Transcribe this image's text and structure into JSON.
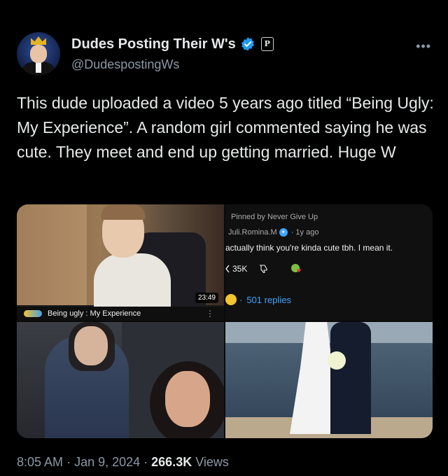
{
  "author": {
    "display_name": "Dudes Posting Their W's",
    "handle": "@DudespostingWs",
    "affiliate_badge": "P"
  },
  "tweet": {
    "text": "This dude uploaded a video 5 years ago titled “Being Ugly: My Experience”. A random girl commented saying he was cute. They meet and end up getting married. Huge W"
  },
  "media": {
    "video": {
      "duration": "23:49",
      "title": "Being ugly : My Experience"
    },
    "comment": {
      "pinned_label": "Pinned by Never Give Up",
      "username": "Juli.Romina.M",
      "age": "· 1y ago",
      "text": "actually think you're kinda cute tbh. I mean it.",
      "likes": "35K",
      "replies": "501 replies"
    }
  },
  "meta": {
    "time": "8:05 AM",
    "date": "Jan 9, 2024",
    "views_count": "266.3K",
    "views_label": "Views"
  },
  "colors": {
    "background": "#000000",
    "text": "#e7e9ea",
    "muted": "#8b98a5",
    "verified": "#1d9bf0",
    "link_blue": "#3ea6ff"
  }
}
